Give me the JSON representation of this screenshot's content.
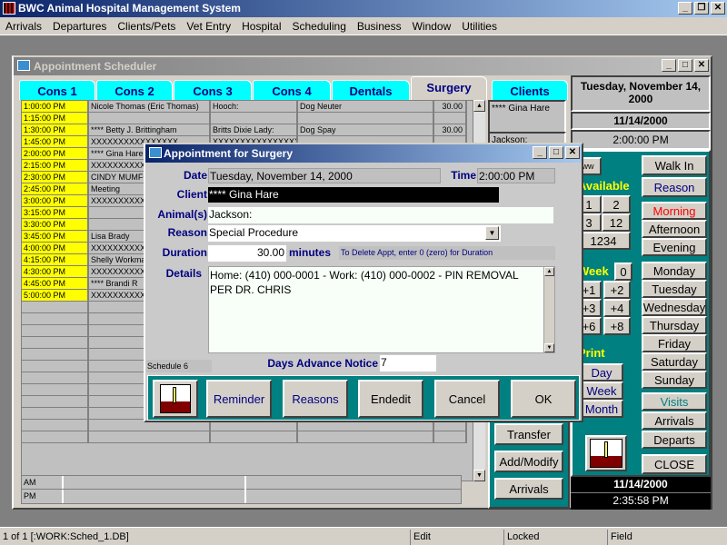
{
  "app": {
    "title": "BWC Animal Hospital Management System"
  },
  "menu": [
    "Arrivals",
    "Departures",
    "Clients/Pets",
    "Vet Entry",
    "Hospital",
    "Scheduling",
    "Business",
    "Window",
    "Utilities"
  ],
  "scheduler": {
    "title": "Appointment Scheduler",
    "tabs": [
      "Cons 1",
      "Cons 2",
      "Cons 3",
      "Cons 4",
      "Dentals",
      "Surgery",
      "Clients"
    ],
    "active_tab": "Surgery",
    "rows": [
      {
        "time": "1:00:00 PM",
        "client": "Nicole Thomas (Eric Thomas)",
        "animal": "Hooch:",
        "reason": "Dog Neuter",
        "duration": "30.00"
      },
      {
        "time": "1:15:00 PM",
        "client": "",
        "animal": "",
        "reason": "",
        "duration": ""
      },
      {
        "time": "1:30:00 PM",
        "client": "**** Betty J. Brittingham",
        "animal": "Britts Dixie Lady:",
        "reason": "Dog Spay",
        "duration": "30.00"
      },
      {
        "time": "1:45:00 PM",
        "client": "XXXXXXXXXXXXXXXX",
        "animal": "XXXXXXXXXXXXXXXX",
        "reason": "",
        "duration": ""
      },
      {
        "time": "2:00:00 PM",
        "client": "**** Gina Hare",
        "animal": "",
        "reason": "",
        "duration": ""
      },
      {
        "time": "2:15:00 PM",
        "client": "XXXXXXXXXXXXXXXX",
        "animal": "",
        "reason": "",
        "duration": ""
      },
      {
        "time": "2:30:00 PM",
        "client": "CINDY MUMFORD",
        "animal": "",
        "reason": "",
        "duration": ""
      },
      {
        "time": "2:45:00 PM",
        "client": "Meeting",
        "animal": "",
        "reason": "",
        "duration": ""
      },
      {
        "time": "3:00:00 PM",
        "client": "XXXXXXXXXXXXXXXX",
        "animal": "",
        "reason": "",
        "duration": ""
      },
      {
        "time": "3:15:00 PM",
        "client": "",
        "animal": "",
        "reason": "",
        "duration": ""
      },
      {
        "time": "3:30:00 PM",
        "client": "",
        "animal": "",
        "reason": "",
        "duration": ""
      },
      {
        "time": "3:45:00 PM",
        "client": "Lisa Brady",
        "animal": "",
        "reason": "",
        "duration": ""
      },
      {
        "time": "4:00:00 PM",
        "client": "XXXXXXXXXXXXXXXX",
        "animal": "",
        "reason": "",
        "duration": ""
      },
      {
        "time": "4:15:00 PM",
        "client": "Shelly Workman",
        "animal": "",
        "reason": "",
        "duration": ""
      },
      {
        "time": "4:30:00 PM",
        "client": "XXXXXXXXXXXXXXXX",
        "animal": "",
        "reason": "",
        "duration": ""
      },
      {
        "time": "4:45:00 PM",
        "client": "**** Brandi R",
        "animal": "",
        "reason": "",
        "duration": ""
      },
      {
        "time": "5:00:00 PM",
        "client": "XXXXXXXXXXXXXXXX",
        "animal": "",
        "reason": "",
        "duration": ""
      }
    ],
    "am_label": "AM",
    "pm_label": "PM",
    "client_panel": {
      "name": "**** Gina Hare",
      "animal": "Jackson:"
    },
    "date_long": "Tuesday, November 14, 2000",
    "date_short": "11/14/2000",
    "time": "2:00:00 PM",
    "side_buttons": [
      "Transfer",
      "Add/Modify",
      "Arrivals"
    ],
    "available": {
      "label": "Available",
      "buttons": [
        "1",
        "2",
        "3",
        "12",
        "1234"
      ]
    },
    "week": {
      "label": "Week",
      "value": "0",
      "buttons": [
        "+1",
        "+2",
        "+3",
        "+4",
        "+6",
        "+8"
      ]
    },
    "print": {
      "label": "Print",
      "buttons": [
        "Day",
        "Week",
        "Month"
      ]
    },
    "right_buttons": {
      "walk_in": "Walk In",
      "reason": "Reason",
      "morning": "Morning",
      "afternoon": "Afternoon",
      "evening": "Evening",
      "days": [
        "Monday",
        "Tuesday",
        "Wednesday",
        "Thursday",
        "Friday",
        "Saturday",
        "Sunday"
      ],
      "visits": "Visits",
      "arrivals": "Arrivals",
      "departs": "Departs",
      "close": "CLOSE"
    },
    "clock": {
      "date": "11/14/2000",
      "time": "2:35:58 PM"
    }
  },
  "dialog": {
    "title": "Appointment for Surgery",
    "labels": {
      "date": "Date",
      "time": "Time",
      "client": "Client",
      "animals": "Animal(s)",
      "reason": "Reason",
      "duration": "Duration",
      "minutes": "minutes",
      "details": "Details",
      "days_notice": "Days Advance Notice"
    },
    "date": "Tuesday, November 14, 2000",
    "time": "2:00:00 PM",
    "client": "**** Gina Hare",
    "animals": "Jackson:",
    "reason": "Special Procedure",
    "duration": "30.00",
    "delete_hint": "To Delete Appt, enter 0 (zero) for Duration",
    "details": "Home: (410) 000-0001 - Work: (410) 000-0002 - PIN REMOVAL PER DR. CHRIS",
    "schedule_label": "Schedule 6",
    "days_notice": "7",
    "buttons": [
      "Reminder",
      "Reasons",
      "Endedit",
      "Cancel",
      "OK"
    ]
  },
  "status": {
    "record": "1 of 1 [:WORK:Sched_1.DB]",
    "mode": "Edit",
    "lock": "Locked",
    "field": "Field"
  },
  "colors": {
    "teal": "#008080",
    "cyan_tab": "#00ffff",
    "time_yellow": "#ffff00",
    "navy": "#000080",
    "morning_red": "#ff0000"
  }
}
